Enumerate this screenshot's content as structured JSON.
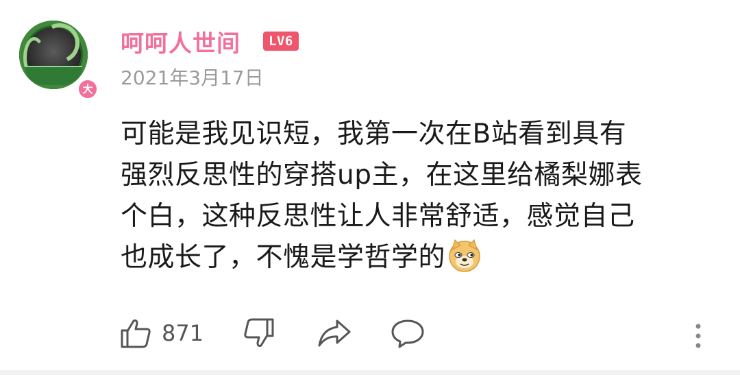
{
  "user": {
    "name": "呵呵人世间",
    "level": "LV6",
    "badge": "大",
    "date": "2021年3月17日"
  },
  "comment": {
    "lines": [
      "可能是我见识短，我第一次在B站看到具有",
      "强烈反思性的穿搭up主，在这里给橘梨娜表",
      "个白，这种反思性让人非常舒适，感觉自己",
      "也成长了，不愧是学哲学的"
    ],
    "emoji": "doge-emoji"
  },
  "actions": {
    "like_count": "871",
    "icons": [
      "thumbs-up-icon",
      "thumbs-down-icon",
      "share-icon",
      "reply-icon",
      "more-icon"
    ]
  },
  "colors": {
    "username": "#f2709c",
    "level_badge": "#f0566b",
    "date": "#9a9a9a",
    "text": "#1a1a1a",
    "icon": "#555555"
  }
}
